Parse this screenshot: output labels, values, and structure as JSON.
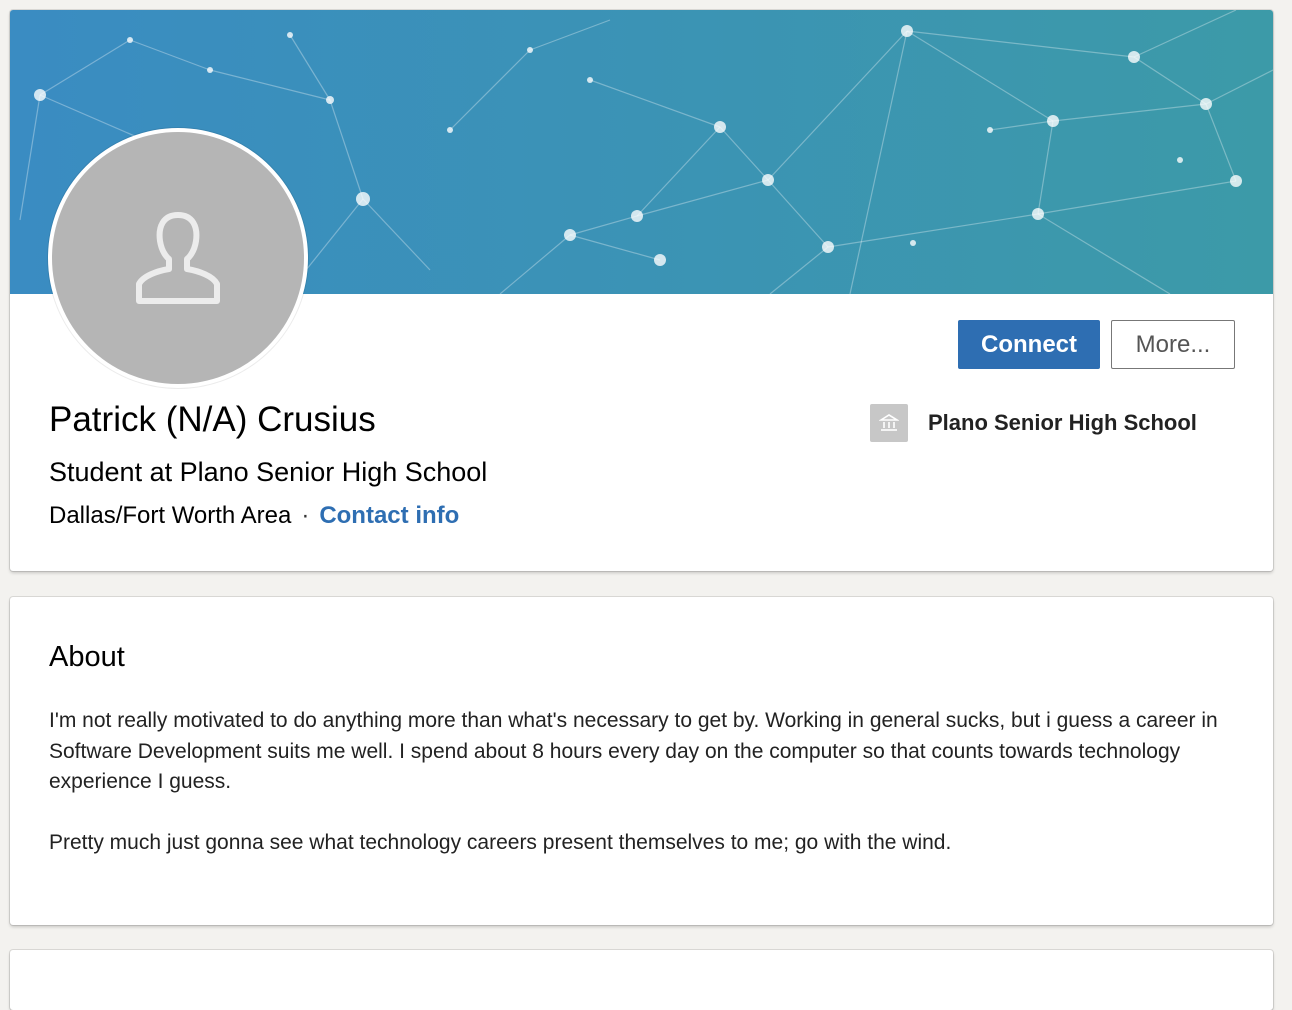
{
  "colors": {
    "banner_left": "#3a8cc2",
    "banner_right": "#3c9aa8",
    "primary_blue": "#2e6eb2",
    "avatar_bg": "#b5b5b5"
  },
  "profile": {
    "avatar_icon": "person-silhouette-icon",
    "name": "Patrick (N/A) Crusius",
    "headline": "Student at Plano Senior High School",
    "location": "Dallas/Fort Worth Area",
    "separator": "·",
    "contact_info": "Contact info"
  },
  "actions": {
    "connect": "Connect",
    "more": "More..."
  },
  "education": {
    "logo_icon": "school-building-icon",
    "school": "Plano Senior High School"
  },
  "about": {
    "title": "About",
    "paragraph_1": "I'm not really motivated to do anything more than what's necessary to get by. Working in general sucks, but i guess a career in Software Development suits me well. I spend about 8 hours every day on the computer so that counts towards technology experience I guess.",
    "paragraph_2": "Pretty much just gonna see what technology careers present themselves to me; go with the wind."
  }
}
